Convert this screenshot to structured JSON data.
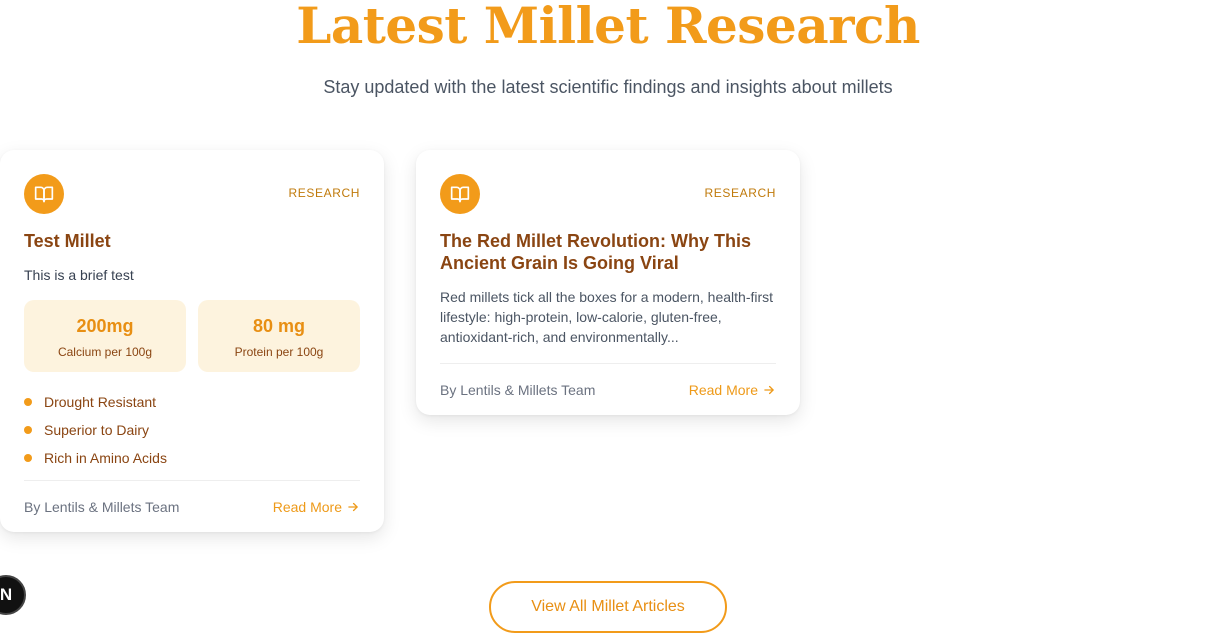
{
  "header": {
    "title": "Latest Millet Research",
    "subtitle": "Stay updated with the latest scientific findings and insights about millets"
  },
  "colors": {
    "accent": "#f29b1a",
    "title_brown": "#8a4512",
    "stat_bg": "#fdf3de"
  },
  "cards": [
    {
      "icon": "book-open-icon",
      "tag": "RESEARCH",
      "title": "Test Millet",
      "description": "This is a brief test",
      "stats": [
        {
          "value": "200mg",
          "label": "Calcium per 100g"
        },
        {
          "value": "80 mg",
          "label": "Protein per 100g"
        }
      ],
      "features": [
        "Drought Resistant",
        "Superior to Dairy",
        "Rich in Amino Acids"
      ],
      "author": "By Lentils & Millets Team",
      "read_more": "Read More"
    },
    {
      "icon": "book-open-icon",
      "tag": "RESEARCH",
      "title": "The Red Millet Revolution: Why This Ancient Grain Is Going Viral",
      "description": "Red millets tick all the boxes for a modern, health-first lifestyle: high-protein, low-calorie, gluten-free, antioxidant-rich, and environmentally...",
      "author": "By Lentils & Millets Team",
      "read_more": "Read More"
    }
  ],
  "view_all_label": "View All Millet Articles",
  "floating_badge": "N"
}
